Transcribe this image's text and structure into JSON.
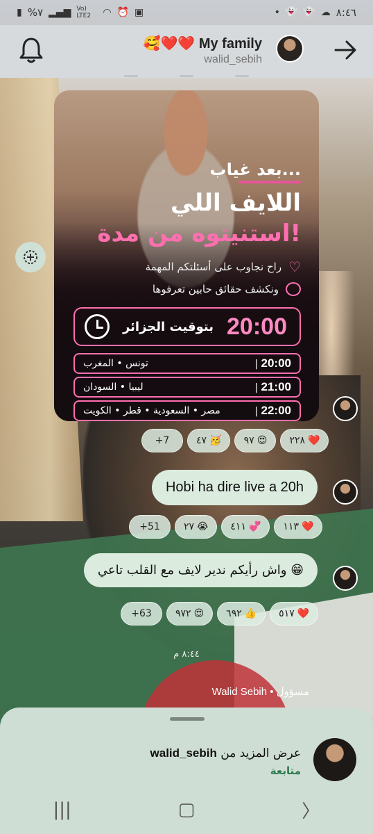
{
  "status_bar": {
    "battery": "%٧",
    "network": "Vo) LTE2",
    "time": "٨:٤٦"
  },
  "header": {
    "group_name": "My family",
    "group_emojis": "🥰❤️❤️",
    "owner": "walid_sebih"
  },
  "poster": {
    "intro": "بعد غياب...",
    "headline_1": "اللايف اللي",
    "headline_2": "استنيتوه من مدة!",
    "bullet_1": "راح نجاوب على أسئلتكم المهمة",
    "bullet_2": "ونكشف حقائق حابين تعرفوها",
    "main_time": "20:00",
    "main_zone": "بتوقيت الجزائر",
    "rows": [
      {
        "time": "20:00",
        "places": "تونس • المغرب"
      },
      {
        "time": "21:00",
        "places": "ليبيا • السودان"
      },
      {
        "time": "22:00",
        "places": "مصر • السعودية • قطر • الكويت"
      }
    ]
  },
  "reactions_1": [
    {
      "emoji": "❤️",
      "count": "٢٢٨"
    },
    {
      "emoji": "😍",
      "count": "٩٧"
    },
    {
      "emoji": "🥳",
      "count": "٤٧"
    },
    {
      "emoji": "",
      "count": "+7"
    }
  ],
  "message_1": "Hobi ha dire live a 20h",
  "reactions_2": [
    {
      "emoji": "❤️",
      "count": "١١٣"
    },
    {
      "emoji": "💞",
      "count": "٤١١"
    },
    {
      "emoji": "😭",
      "count": "٢٧"
    },
    {
      "emoji": "",
      "count": "+51"
    }
  ],
  "message_2": "واش رأيكم ندير لايف مع القلب تاعي 😁",
  "reactions_3": [
    {
      "emoji": "❤️",
      "count": "٥١٧"
    },
    {
      "emoji": "👍",
      "count": "٦٩٢"
    },
    {
      "emoji": "😍",
      "count": "٩٧٢"
    },
    {
      "emoji": "",
      "count": "+63"
    }
  ],
  "timestamp": "٨:٤٤ م",
  "admin_line": "Walid Sebih • مسؤول",
  "sheet": {
    "title_prefix": "عرض المزيد من",
    "title_user": "walid_sebih",
    "follow": "متابعة"
  }
}
